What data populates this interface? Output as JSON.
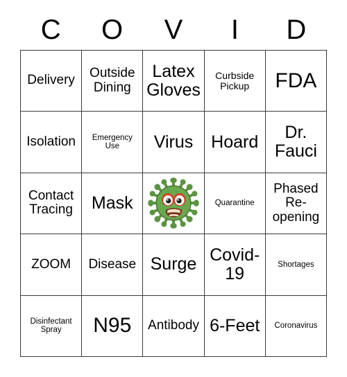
{
  "card": {
    "title_letters": [
      "C",
      "O",
      "V",
      "I",
      "D"
    ],
    "colors": {
      "border": "#3a3a3a",
      "background": "#ffffff",
      "text": "#000000",
      "virus_body": "#6aa84f",
      "virus_body_dark": "#4e7a35",
      "virus_spike": "#5b9440",
      "virus_eye_ring": "#d9381e",
      "virus_eye_white": "#ffffff",
      "virus_pupil": "#1d1d1b",
      "virus_mouth": "#7b2d1c",
      "virus_teeth": "#f2e3c4"
    },
    "grid": {
      "columns": 5,
      "rows": 5,
      "cells": [
        [
          {
            "text": "Delivery",
            "size": "sz-md"
          },
          {
            "text": "Outside Dining",
            "size": "sz-md"
          },
          {
            "text": "Latex Gloves",
            "size": "sz-lg"
          },
          {
            "text": "Curbside Pickup",
            "size": "sz-sm"
          },
          {
            "text": "FDA",
            "size": "sz-xl"
          }
        ],
        [
          {
            "text": "Isolation",
            "size": "sz-md"
          },
          {
            "text": "Emergency Use",
            "size": "sz-xs"
          },
          {
            "text": "Virus",
            "size": "sz-lg"
          },
          {
            "text": "Hoard",
            "size": "sz-lg"
          },
          {
            "text": "Dr. Fauci",
            "size": "sz-lg"
          }
        ],
        [
          {
            "text": "Contact Tracing",
            "size": "sz-md"
          },
          {
            "text": "Mask",
            "size": "sz-lg"
          },
          {
            "text": "",
            "size": "sz-md",
            "icon": "virus-icon",
            "free_space": true
          },
          {
            "text": "Quarantine",
            "size": "sz-xs"
          },
          {
            "text": "Phased Re-opening",
            "size": "sz-md"
          }
        ],
        [
          {
            "text": "ZOOM",
            "size": "sz-md"
          },
          {
            "text": "Disease",
            "size": "sz-md"
          },
          {
            "text": "Surge",
            "size": "sz-lg"
          },
          {
            "text": "Covid-19",
            "size": "sz-lg"
          },
          {
            "text": "Shortages",
            "size": "sz-xs"
          }
        ],
        [
          {
            "text": "Disinfectant Spray",
            "size": "sz-xs"
          },
          {
            "text": "N95",
            "size": "sz-xl"
          },
          {
            "text": "Antibody",
            "size": "sz-md"
          },
          {
            "text": "6-Feet",
            "size": "sz-lg"
          },
          {
            "text": "Coronavirus",
            "size": "sz-xs"
          }
        ]
      ]
    }
  }
}
